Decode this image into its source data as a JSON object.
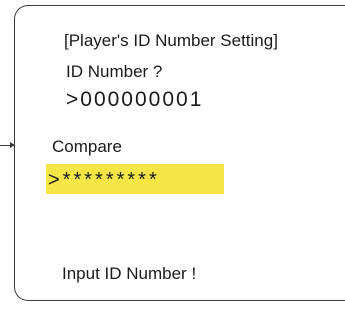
{
  "screen": {
    "title": "[Player's ID Number Setting]",
    "id_label": "ID Number  ?",
    "id_value": ">000000001",
    "compare_label": "Compare",
    "compare_value": ">*********",
    "status_message": "Input ID Number !"
  },
  "colors": {
    "highlight": "#f5e545",
    "frame": "#3a3a3a",
    "text": "#1a1a1a"
  },
  "icons": {
    "pointer": "arrow-right-icon"
  }
}
